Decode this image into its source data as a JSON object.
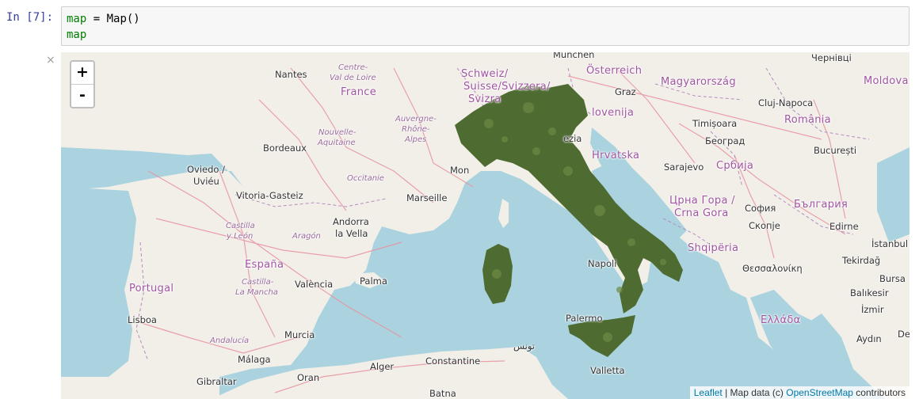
{
  "cell": {
    "prompt": "In [7]:",
    "code_line1_var": "map",
    "code_line1_rest": " = Map()",
    "code_line2": "map"
  },
  "output": {
    "close_symbol": "×"
  },
  "map": {
    "zoom_in": "+",
    "zoom_out": "-",
    "attribution": {
      "leaflet": "Leaflet",
      "sep": " | Map data (c) ",
      "osm": "OpenStreetMap",
      "suffix": " contributors"
    },
    "colors": {
      "sea": "#aad3df",
      "land": "#f2efe9",
      "overlay": "#4e6b32"
    },
    "labels": {
      "munchen": "München",
      "chernivtsi": "Чернівці",
      "nantes": "Nantes",
      "centre1": "Centre-",
      "centre2": "Val de Loire",
      "schweiz1": "Schweiz/",
      "schweiz2": "Suisse/Svizzera/",
      "schweiz3": "Svizra",
      "osterreich": "Österreich",
      "magyar": "Magyarország",
      "moldova": "Moldova",
      "france": "France",
      "graz": "Graz",
      "cluj": "Cluj-Napoca",
      "slovenija": "lovenija",
      "romania": "România",
      "auvergne1": "Auvergne-",
      "auvergne2": "Rhône-",
      "auvergne3": "Alpes",
      "nouvelle1": "Nouvelle-",
      "nouvelle2": "Aquitaine",
      "timisoara": "Timișoara",
      "beograd": "Београд",
      "bordeaux": "Bordeaux",
      "venezia": "ezia",
      "bucuresti": "București",
      "hrvatska": "Hrvatska",
      "oviedo1": "Oviedo /",
      "oviedo2": "Uviéu",
      "monaco": "Mon",
      "sarajevo": "Sarajevo",
      "srbija": "Србија",
      "occitanie": "Occitanie",
      "vitoria": "Vitoria-Gasteiz",
      "marseille": "Marseille",
      "crnagora1": "Црна Гора /",
      "crnagora2": "Crna Gora",
      "sofia": "София",
      "bulgaria": "България",
      "andorra1": "Andorra",
      "andorra2": "la Vella",
      "skopje": "Скопје",
      "edirne": "Edirne",
      "castilla1": "Castilla",
      "castilla2": "y León",
      "aragon": "Aragón",
      "istanbul": "İstanbul",
      "shqiperia": "Shqipëria",
      "tekirdag": "Tekirdağ",
      "napoli": "Napoli",
      "espana": "España",
      "thessaloniki": "Θεσσαλονίκη",
      "palma": "Palma",
      "bursa": "Bursa",
      "portugal": "Portugal",
      "castillalm1": "Castilla-",
      "castillalm2": "La Mancha",
      "valencia": "València",
      "balikesir": "Balıkesir",
      "lisboa": "Lisboa",
      "palermo": "Palermo",
      "ellada": "Ελλάδα",
      "izmir": "İzmir",
      "murcia": "Murcia",
      "andalucia": "Andalucía",
      "aydin": "Aydın",
      "de": "De",
      "tunis": "تونس",
      "malaga": "Málaga",
      "alger": "Alger",
      "constantine": "Constantine",
      "gibraltar": "Gibraltar",
      "oran": "Oran",
      "valletta": "Valletta",
      "batna": "Batna"
    }
  }
}
